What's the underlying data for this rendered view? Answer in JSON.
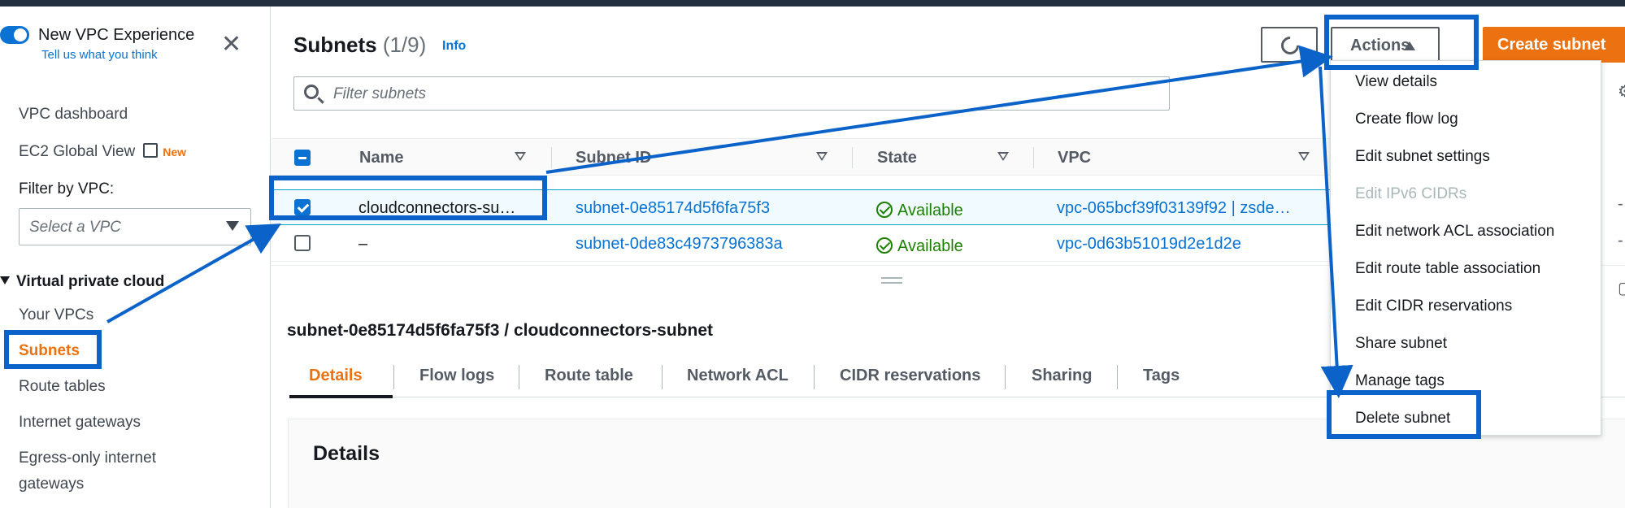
{
  "colors": {
    "accent_blue": "#0972d3",
    "primary_orange": "#ec7211",
    "highlight_blue": "#0b62c9",
    "success_green": "#1d8102"
  },
  "sidebar": {
    "new_vpc_title": "New VPC Experience",
    "new_vpc_link": "Tell us what you think",
    "close_icon": "close-icon",
    "vpc_dashboard": "VPC dashboard",
    "ec2_global_view": "EC2 Global View",
    "new_badge": "New",
    "filter_label": "Filter by VPC:",
    "vpc_select_placeholder": "Select a VPC",
    "section_title": "Virtual private cloud",
    "items": [
      "Your VPCs",
      "Subnets",
      "Route tables",
      "Internet gateways",
      "Egress-only internet",
      "gateways"
    ],
    "active_item": "Subnets"
  },
  "main": {
    "title": "Subnets",
    "count": "(1/9)",
    "info": "Info",
    "actions_label": "Actions",
    "create_label": "Create subnet",
    "search_placeholder": "Filter subnets",
    "columns": [
      "Name",
      "Subnet ID",
      "State",
      "VPC"
    ],
    "rows": [
      {
        "name": "cloudconnectors-su…",
        "subnet_id": "subnet-0e85174d5f6fa75f3",
        "state": "Available",
        "vpc": "vpc-065bcf39f03139f92 | zsde…",
        "selected": true
      },
      {
        "name": "–",
        "subnet_id": "subnet-0de83c4973796383a",
        "state": "Available",
        "vpc": "vpc-0d63b51019d2e1d2e",
        "selected": false
      }
    ]
  },
  "details": {
    "title": "subnet-0e85174d5f6fa75f3 / cloudconnectors-subnet",
    "tabs": [
      "Details",
      "Flow logs",
      "Route table",
      "Network ACL",
      "CIDR reservations",
      "Sharing",
      "Tags"
    ],
    "active_tab": "Details",
    "section_title": "Details"
  },
  "actions_menu": {
    "items": [
      "View details",
      "Create flow log",
      "Edit subnet settings",
      "Edit IPv6 CIDRs",
      "Edit network ACL association",
      "Edit route table association",
      "Edit CIDR reservations",
      "Share subnet",
      "Manage tags",
      "Delete subnet"
    ],
    "disabled": [
      "Edit IPv6 CIDRs"
    ],
    "highlighted": "Delete subnet"
  }
}
